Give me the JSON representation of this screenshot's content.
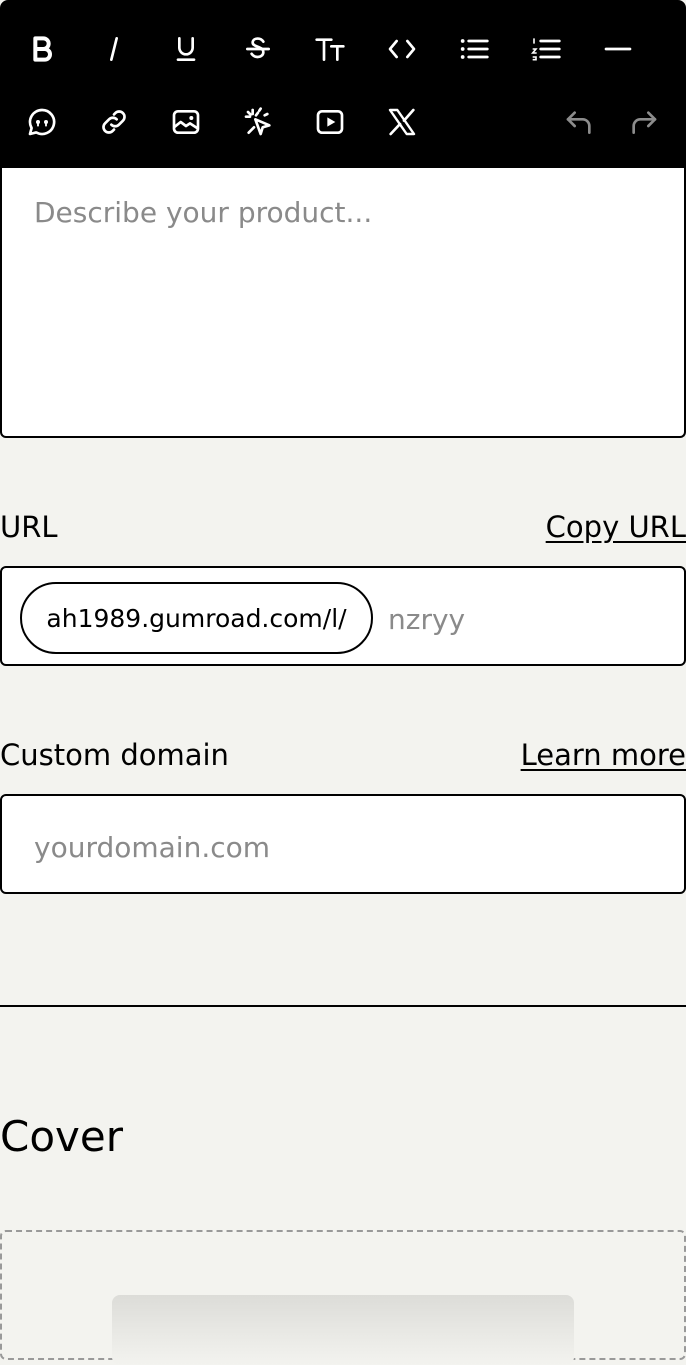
{
  "toolbar": {
    "row1": [
      "bold-icon",
      "italic-icon",
      "underline-icon",
      "strikethrough-icon",
      "text-size-icon",
      "code-icon",
      "bullet-list-icon",
      "numbered-list-icon",
      "horizontal-rule-icon"
    ],
    "row2": [
      "quote-bubble-icon",
      "link-icon",
      "image-icon",
      "sparkle-cursor-icon",
      "video-play-icon",
      "x-logo-icon",
      "undo-icon",
      "redo-icon"
    ]
  },
  "editor": {
    "placeholder": "Describe your product..."
  },
  "url": {
    "label": "URL",
    "copy_link": "Copy URL",
    "prefix": "ah1989.gumroad.com/l/",
    "value_placeholder": "nzryy"
  },
  "custom_domain": {
    "label": "Custom domain",
    "learn_more": "Learn more",
    "placeholder": "yourdomain.com"
  },
  "cover": {
    "heading": "Cover"
  }
}
